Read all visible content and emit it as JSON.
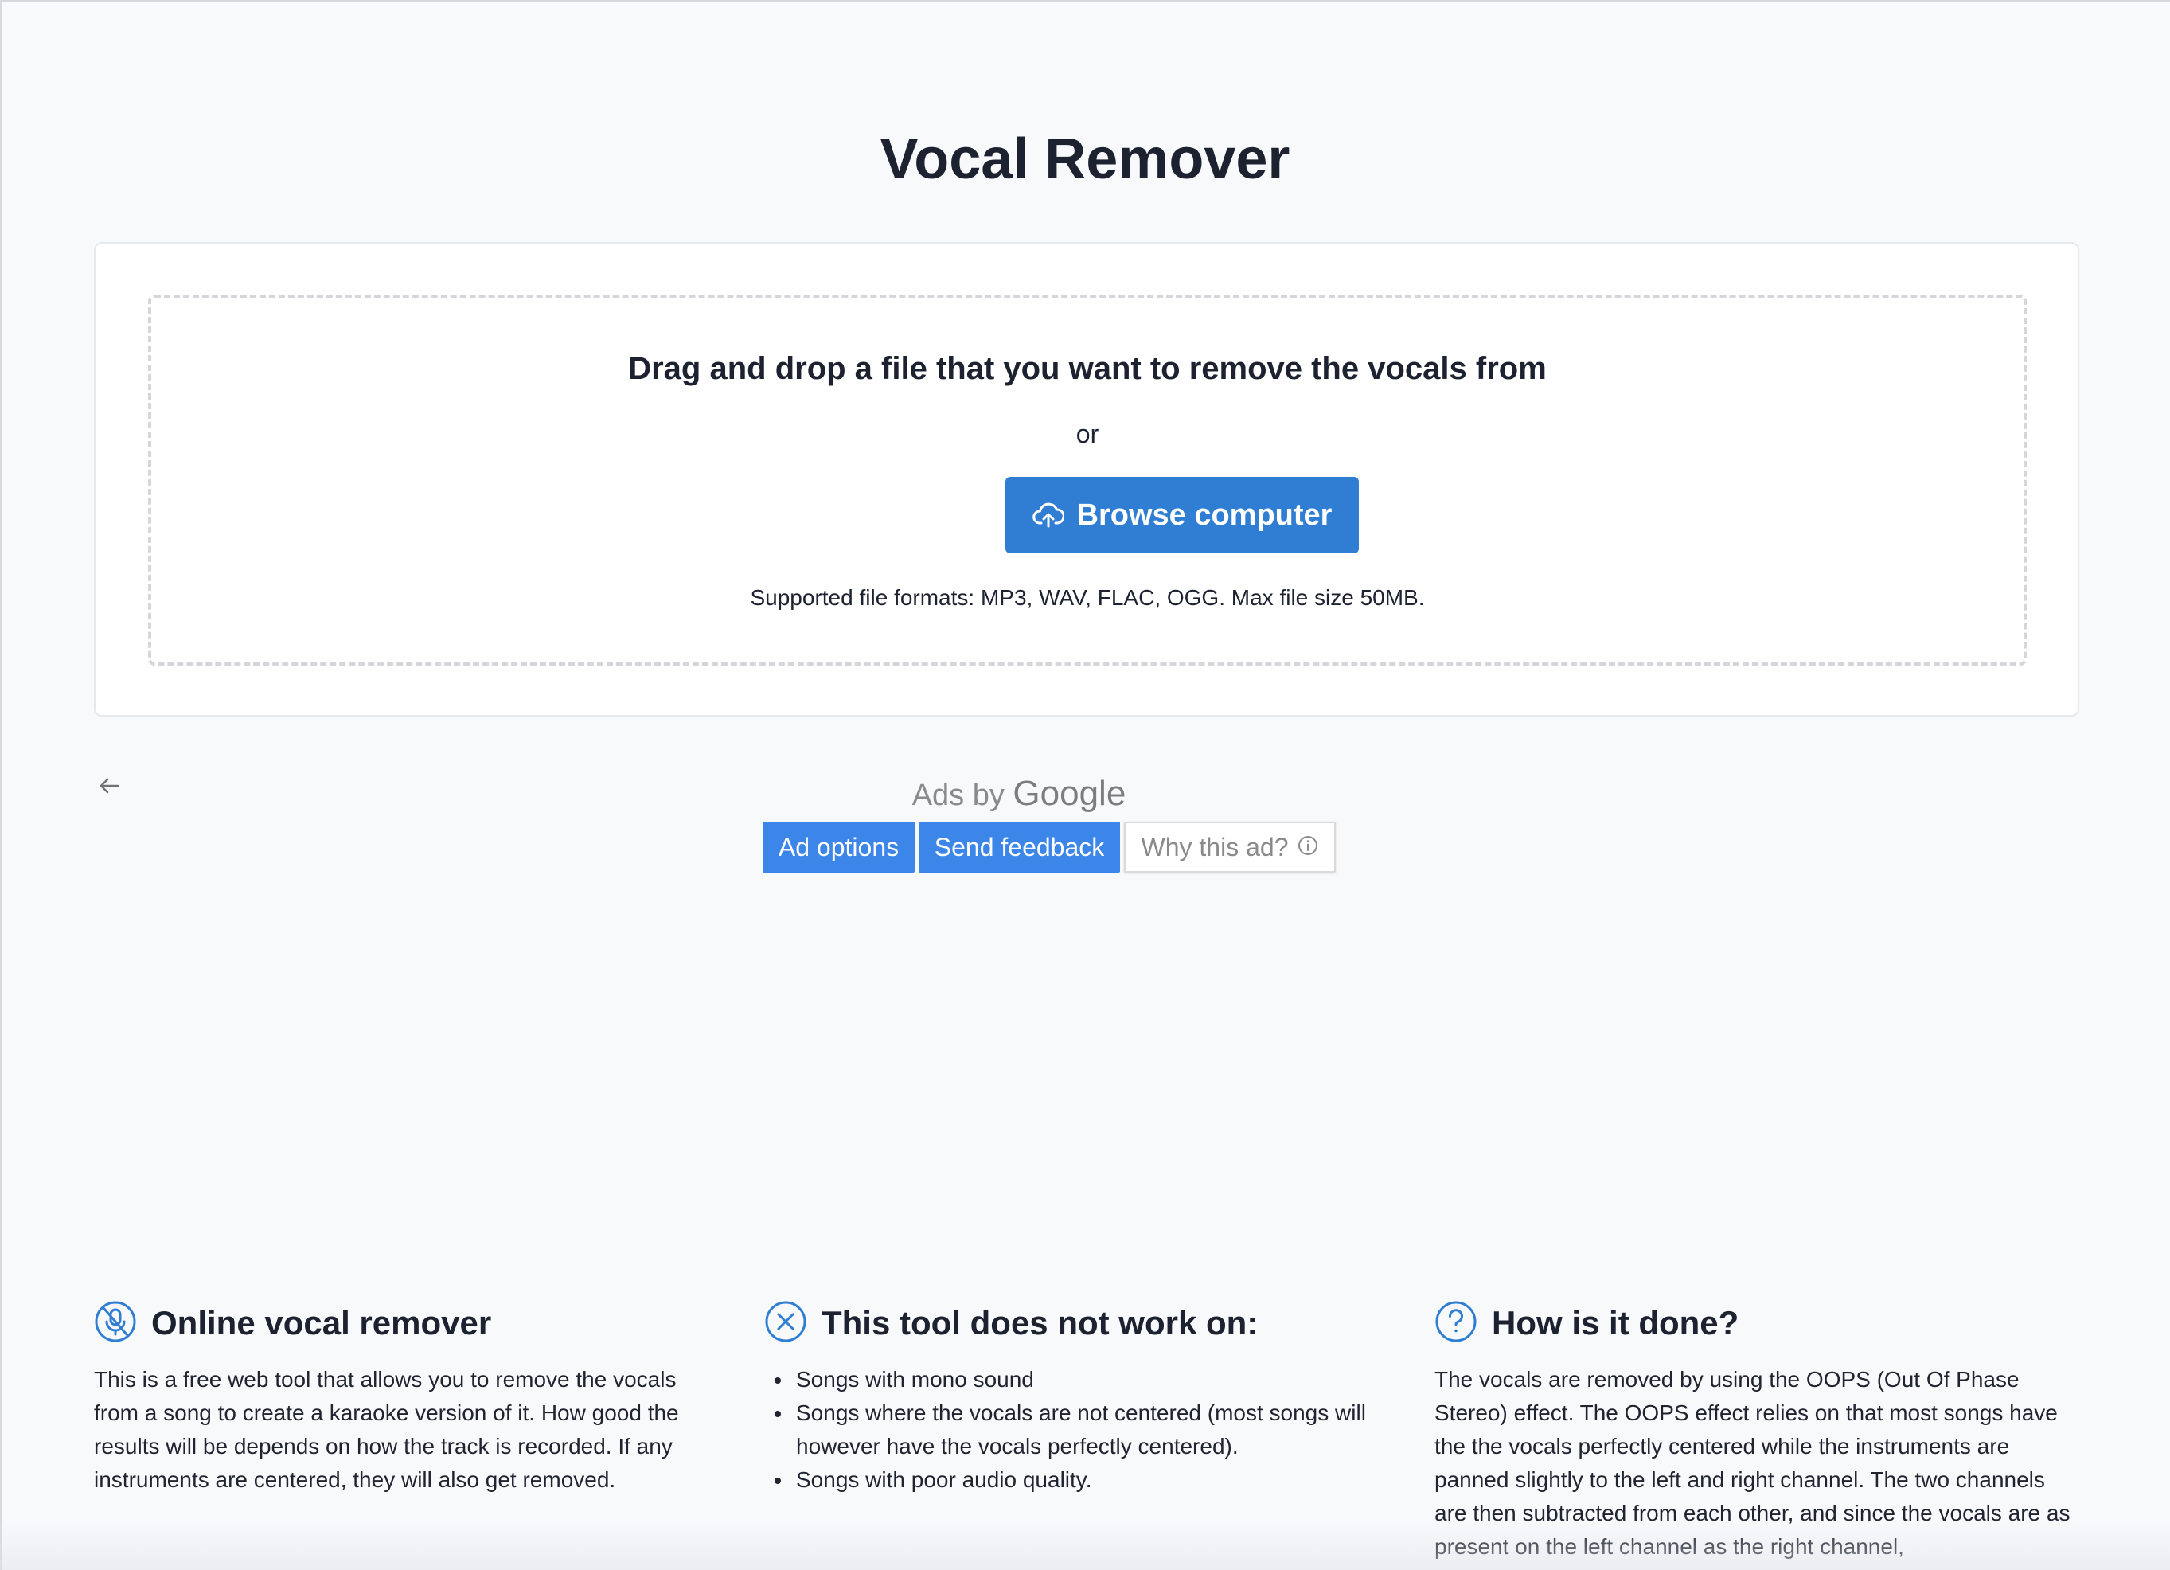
{
  "page": {
    "title": "Vocal Remover"
  },
  "upload": {
    "heading": "Drag and drop a file that you want to remove the vocals from",
    "or_text": "or",
    "browse_label": "Browse computer",
    "formats_note": "Supported file formats: MP3, WAV, FLAC, OGG. Max file size 50MB."
  },
  "ads": {
    "ads_by_prefix": "Ads by",
    "ads_by_brand": "Google",
    "ad_options_label": "Ad options",
    "send_feedback_label": "Send feedback",
    "why_ad_label": "Why this ad?"
  },
  "info": {
    "online": {
      "icon": "microphone-off-icon",
      "title": "Online vocal remover",
      "body": "This is a free web tool that allows you to remove the vocals from a song to create a karaoke version of it. How good the results will be depends on how the track is recorded. If any instruments are centered, they will also get removed."
    },
    "limits": {
      "icon": "close-circle-icon",
      "title": "This tool does not work on:",
      "items": [
        "Songs with mono sound",
        "Songs where the vocals are not centered (most songs will however have the vocals perfectly centered).",
        "Songs with poor audio quality."
      ]
    },
    "how": {
      "icon": "question-circle-icon",
      "title": "How is it done?",
      "body": "The vocals are removed by using the OOPS (Out Of Phase Stereo) effect. The OOPS effect relies on that most songs have the the vocals perfectly centered while the instruments are panned slightly to the left and right channel. The two channels are then subtracted from each other, and since the vocals are as present on the left channel as the right channel,"
    }
  },
  "colors": {
    "primary": "#2f7ed3",
    "ad_blue": "#3c86ea",
    "text_dark": "#1c2230",
    "background": "#f8f9fb"
  }
}
